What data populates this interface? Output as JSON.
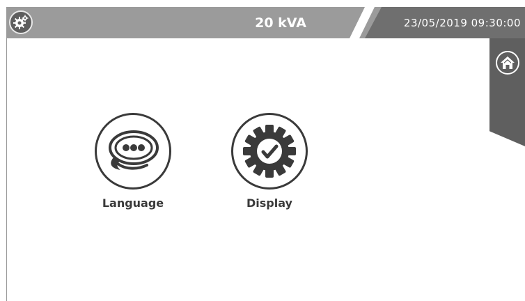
{
  "header": {
    "power_rating": "20 kVA",
    "datetime": "23/05/2019 09:30:00",
    "settings_icon": "gears-icon"
  },
  "side_tab": {
    "home_icon": "home-icon"
  },
  "menu": {
    "items": [
      {
        "label": "Language",
        "icon": "speech-bubble-icon"
      },
      {
        "label": "Display",
        "icon": "gear-check-icon"
      }
    ]
  },
  "colors": {
    "header_bar": "#9b9b9b",
    "header_dark": "#6f6f6f",
    "side_tab": "#5f5f5f",
    "icon_stroke": "#3a3a3a"
  }
}
